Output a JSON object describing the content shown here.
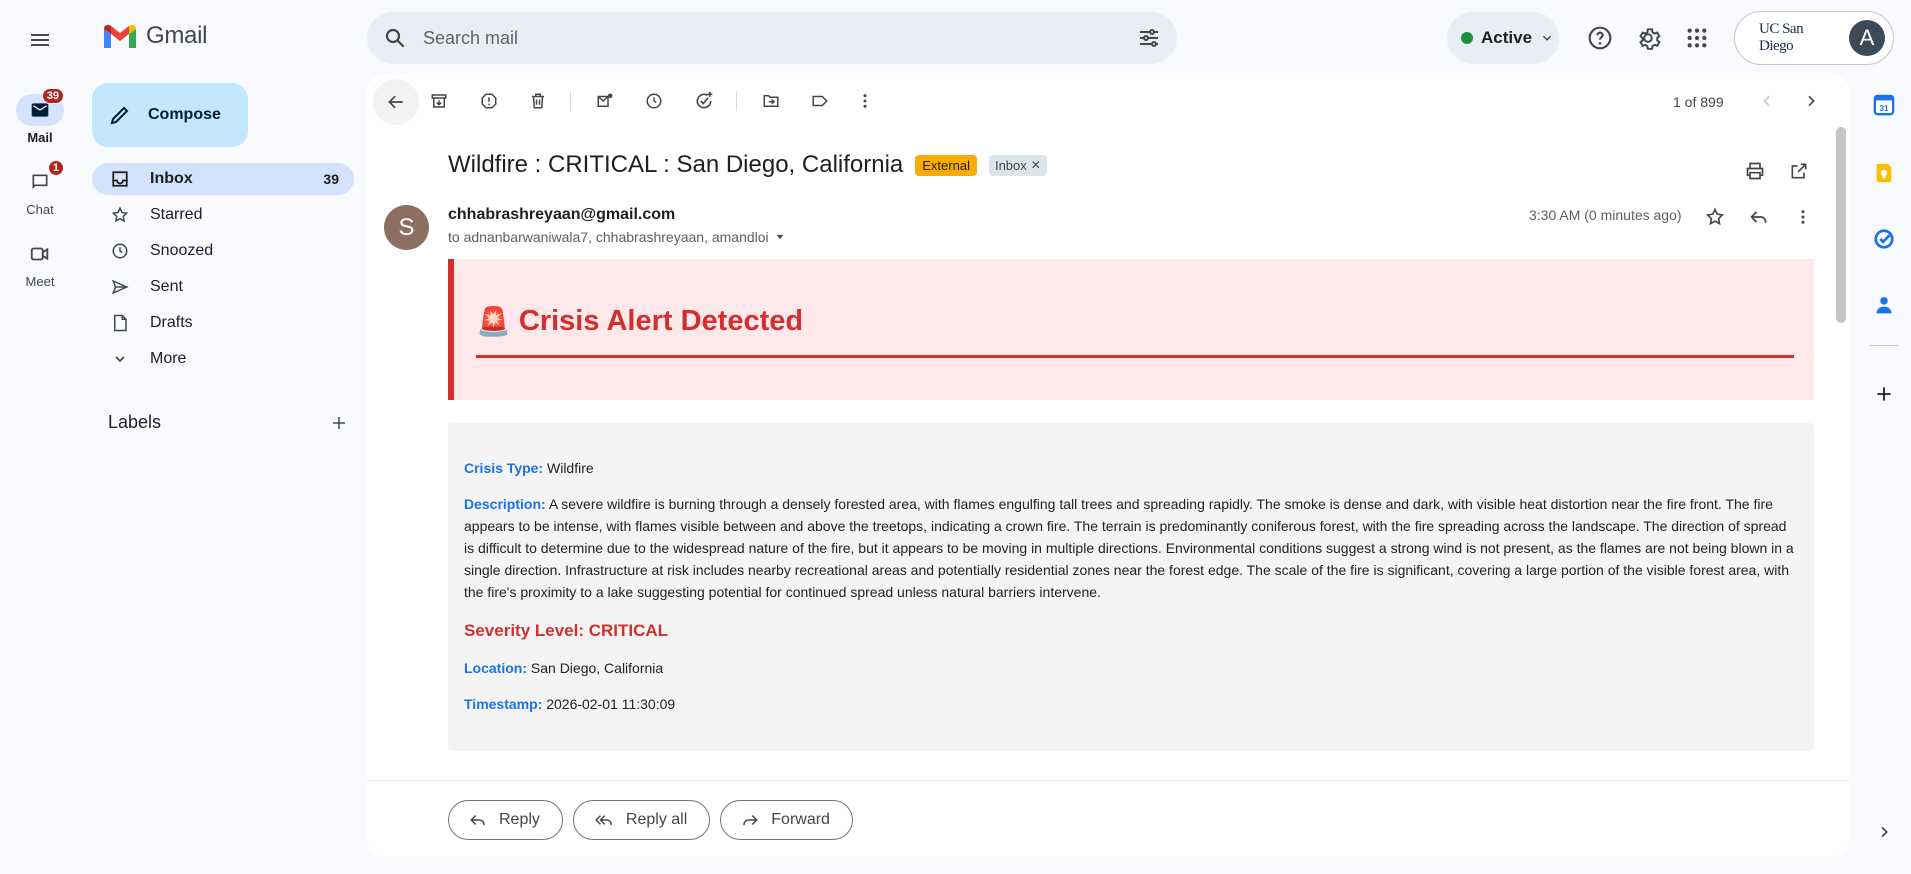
{
  "app": {
    "name": "Gmail"
  },
  "rail": {
    "items": [
      {
        "label": "Mail",
        "badge": "39"
      },
      {
        "label": "Chat",
        "badge": "1"
      },
      {
        "label": "Meet",
        "badge": ""
      }
    ]
  },
  "search": {
    "placeholder": "Search mail"
  },
  "status": {
    "label": "Active",
    "color": "#1e8e3e"
  },
  "account": {
    "org_logo": "UC San Diego",
    "avatar_letter": "A"
  },
  "compose": {
    "label": "Compose"
  },
  "nav": {
    "items": [
      {
        "label": "Inbox",
        "count": "39",
        "icon": "inbox-icon"
      },
      {
        "label": "Starred",
        "count": "",
        "icon": "star-icon"
      },
      {
        "label": "Snoozed",
        "count": "",
        "icon": "clock-icon"
      },
      {
        "label": "Sent",
        "count": "",
        "icon": "send-icon"
      },
      {
        "label": "Drafts",
        "count": "",
        "icon": "draft-icon"
      },
      {
        "label": "More",
        "count": "",
        "icon": "chevron-down-icon"
      }
    ],
    "labels_title": "Labels"
  },
  "toolbar": {
    "pager": "1 of 899"
  },
  "email": {
    "subject": "Wildfire : CRITICAL : San Diego, California",
    "tags": {
      "external": "External",
      "inbox": "Inbox"
    },
    "sender": "chhabrashreyaan@gmail.com",
    "sender_initial": "S",
    "recipients": "to adnanbarwaniwala7, chhabrashreyaan, amandloi",
    "time": "3:30 AM (0 minutes ago)",
    "alert_title": "Crisis Alert Detected",
    "alert_emoji": "🚨",
    "details": {
      "crisis_type_key": "Crisis Type:",
      "crisis_type": "Wildfire",
      "description_key": "Description:",
      "description": "A severe wildfire is burning through a densely forested area, with flames engulfing tall trees and spreading rapidly. The smoke is dense and dark, with visible heat distortion near the fire front. The fire appears to be intense, with flames visible between and above the treetops, indicating a crown fire. The terrain is predominantly coniferous forest, with the fire spreading across the landscape. The direction of spread is difficult to determine due to the widespread nature of the fire, but it appears to be moving in multiple directions. Environmental conditions suggest a strong wind is not present, as the flames are not being blown in a single direction. Infrastructure at risk includes nearby recreational areas and potentially residential zones near the forest edge. The scale of the fire is significant, covering a large portion of the visible forest area, with the fire's proximity to a lake suggesting potential for continued spread unless natural barriers intervene.",
      "severity": "Severity Level: CRITICAL",
      "location_key": "Location:",
      "location": "San Diego, California",
      "timestamp_key": "Timestamp:",
      "timestamp": "2026-02-01 11:30:09"
    },
    "actions": {
      "reply": "Reply",
      "reply_all": "Reply all",
      "forward": "Forward"
    }
  },
  "colors": {
    "accent": "#0b57d0",
    "alert_red": "#d32f2f",
    "key_blue": "#1a73e8",
    "external_tag": "#f9ab00"
  }
}
